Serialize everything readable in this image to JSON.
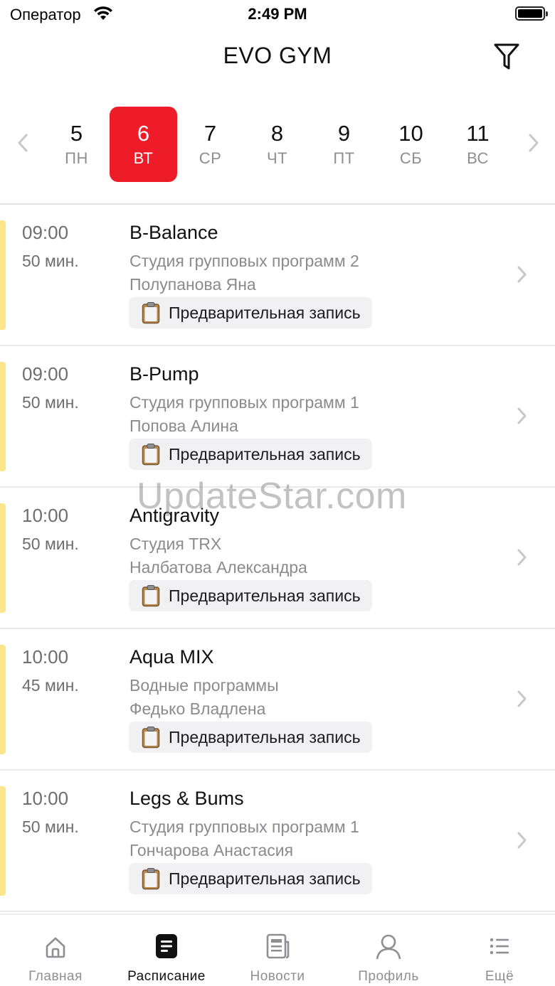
{
  "status_bar": {
    "carrier": "Оператор",
    "time": "2:49 PM"
  },
  "header": {
    "title": "EVO GYM",
    "filter_icon": "filter-icon"
  },
  "week": {
    "days": [
      {
        "num": "5",
        "weekday": "ПН"
      },
      {
        "num": "6",
        "weekday": "ВТ"
      },
      {
        "num": "7",
        "weekday": "СР"
      },
      {
        "num": "8",
        "weekday": "ЧТ"
      },
      {
        "num": "9",
        "weekday": "ПТ"
      },
      {
        "num": "10",
        "weekday": "СБ"
      },
      {
        "num": "11",
        "weekday": "ВС"
      }
    ],
    "selected": "6",
    "accent_color": "#ee1c28"
  },
  "classes": [
    {
      "time": "09:00",
      "duration": "50 мин.",
      "name": "B-Balance",
      "studio": "Студия групповых программ 2",
      "trainer": "Полупанова  Яна",
      "badge": "Предварительная запись"
    },
    {
      "time": "09:00",
      "duration": "50 мин.",
      "name": "B-Pump",
      "studio": "Студия групповых программ 1",
      "trainer": "Попова Алина",
      "badge": "Предварительная запись"
    },
    {
      "time": "10:00",
      "duration": "50 мин.",
      "name": "Antigravity",
      "studio": "Студия TRX",
      "trainer": "Налбатова Александра",
      "badge": "Предварительная запись"
    },
    {
      "time": "10:00",
      "duration": "45 мин.",
      "name": "Aqua MIX",
      "studio": "Водные программы",
      "trainer": "Федько Владлена",
      "badge": "Предварительная запись"
    },
    {
      "time": "10:00",
      "duration": "50 мин.",
      "name": "Legs & Bums",
      "studio": "Студия групповых программ 1",
      "trainer": "Гончарова Анастасия",
      "badge": "Предварительная запись"
    }
  ],
  "class_accent_color": "#fde58c",
  "tabbar": {
    "tabs": [
      {
        "label": "Главная",
        "icon": "home-icon"
      },
      {
        "label": "Расписание",
        "icon": "schedule-icon"
      },
      {
        "label": "Новости",
        "icon": "news-icon"
      },
      {
        "label": "Профиль",
        "icon": "profile-icon"
      },
      {
        "label": "Ещё",
        "icon": "more-icon"
      }
    ],
    "active": "Расписание"
  },
  "watermark": "UpdateStar.com"
}
